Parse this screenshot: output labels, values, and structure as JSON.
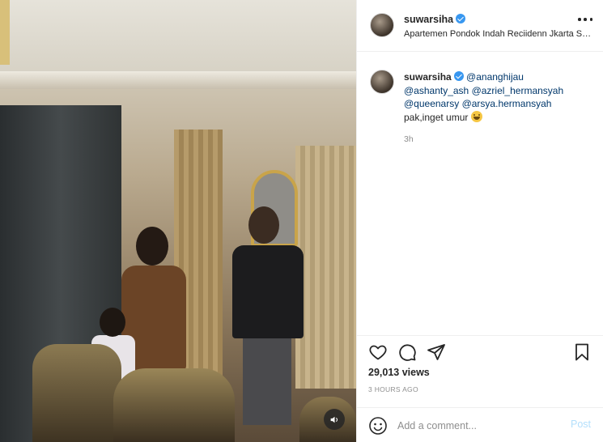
{
  "post": {
    "username": "suwarsiha",
    "location": "Apartemen Pondok Indah Reciidenn Jkarta Sel...",
    "views": "29,013 views",
    "age": "3 HOURS AGO"
  },
  "caption": {
    "username": "suwarsiha",
    "mentions": [
      "@ananghijau",
      "@ashanty_ash",
      "@azriel_hermansyah",
      "@queenarsy",
      "@arsya.hermansyah"
    ],
    "text": "pak,inget umur",
    "time": "3h"
  },
  "comment_box": {
    "placeholder": "Add a comment...",
    "post_label": "Post"
  },
  "icons": {
    "like": "heart-icon",
    "comment": "comment-icon",
    "share": "paper-plane-icon",
    "save": "bookmark-icon",
    "sound": "speaker-icon",
    "more": "more-options-icon",
    "emoji": "smiley-icon"
  },
  "colors": {
    "verified": "#3897f0",
    "mention": "#00376b",
    "post_button": "#b2dffc"
  }
}
